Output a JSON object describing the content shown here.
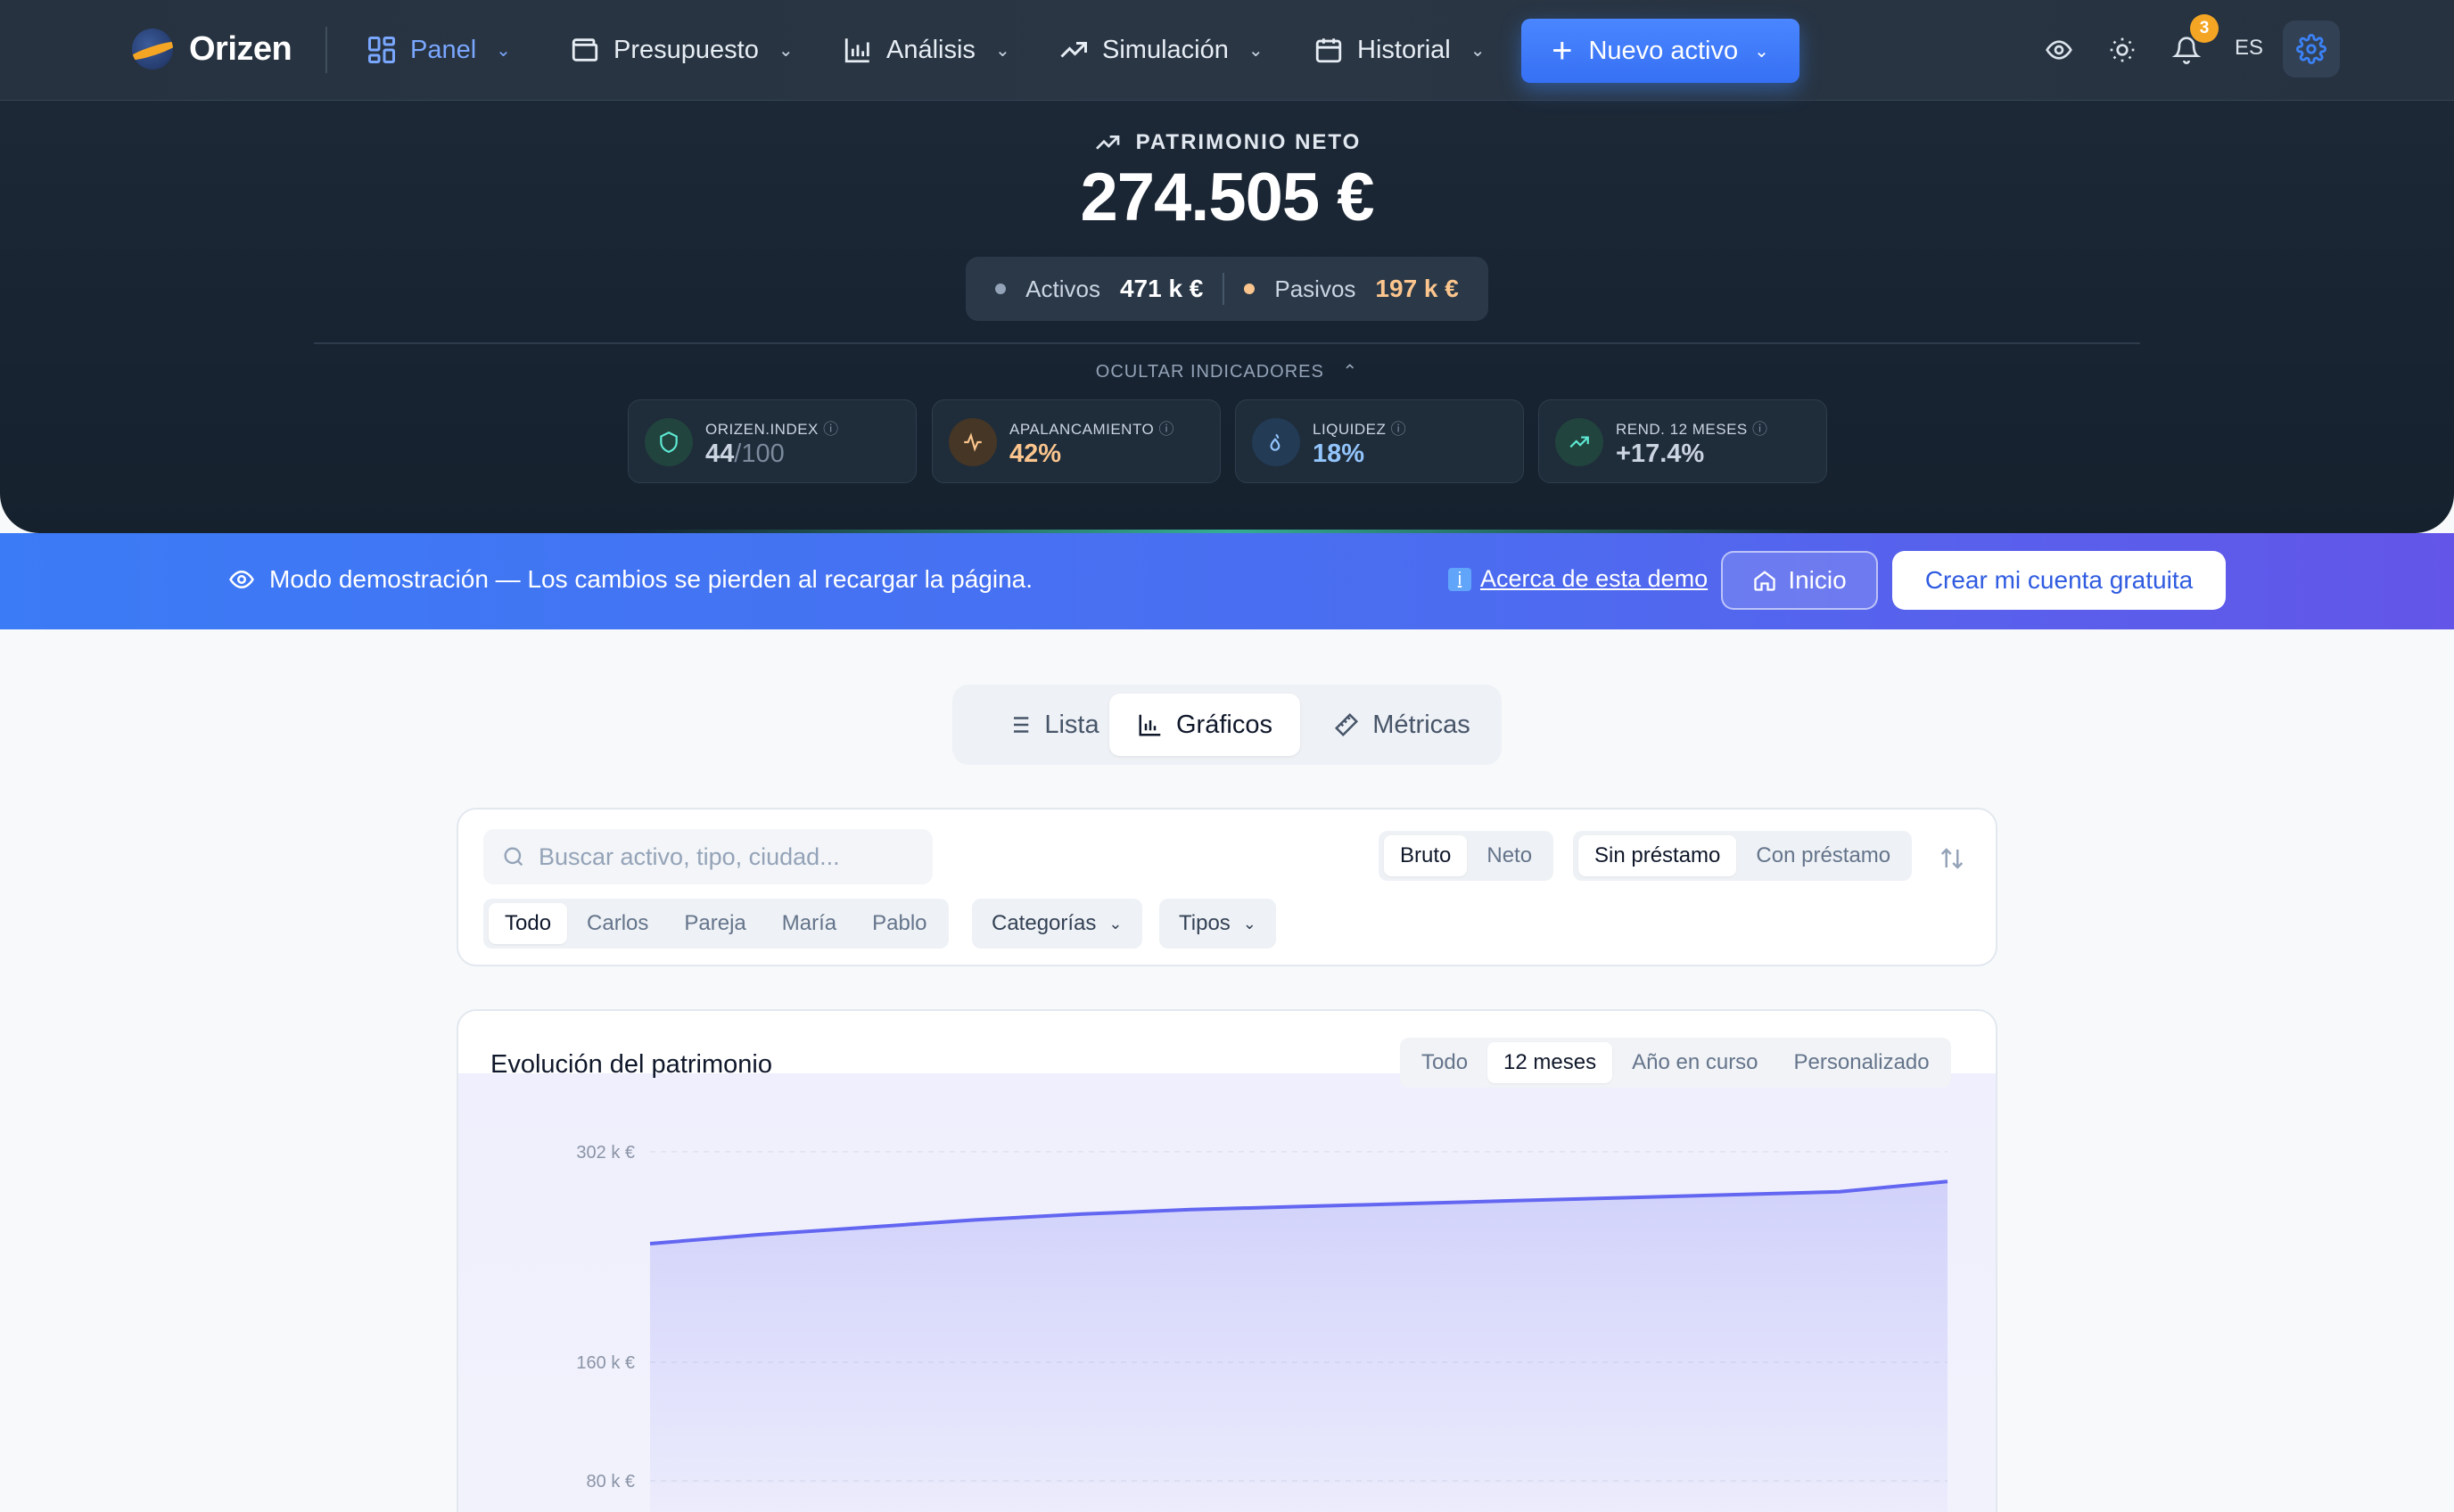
{
  "app": {
    "name": "Orizen"
  },
  "nav": {
    "items": [
      {
        "label": "Panel"
      },
      {
        "label": "Presupuesto"
      },
      {
        "label": "Análisis"
      },
      {
        "label": "Simulación"
      },
      {
        "label": "Historial"
      }
    ],
    "new_button": "Nuevo activo",
    "notifications_count": "3",
    "language": "ES"
  },
  "networth": {
    "label": "PATRIMONIO NETO",
    "value": "274.505 €",
    "assets_label": "Activos",
    "assets_value": "471 k €",
    "liabilities_label": "Pasivos",
    "liabilities_value": "197 k €",
    "hide_indicators": "OCULTAR INDICADORES"
  },
  "kpis": [
    {
      "label": "ORIZEN.INDEX",
      "value": "44",
      "suffix": "/100",
      "color": "#cbd5e1"
    },
    {
      "label": "APALANCAMIENTO",
      "value": "42%",
      "suffix": "",
      "color": "#fbc58d"
    },
    {
      "label": "LIQUIDEZ",
      "value": "18%",
      "suffix": "",
      "color": "#93c5fd"
    },
    {
      "label": "REND. 12 MESES",
      "value": "+17.4%",
      "suffix": "",
      "color": "#cbd5e1"
    }
  ],
  "demo": {
    "message": "Modo demostración — Los cambios se pierden al recargar la página.",
    "about_link": "Acerca de esta demo",
    "home_button": "Inicio",
    "create_button": "Crear mi cuenta gratuita"
  },
  "view_tabs": [
    {
      "label": "Lista",
      "active": false
    },
    {
      "label": "Gráficos",
      "active": true
    },
    {
      "label": "Métricas",
      "active": false
    }
  ],
  "filters": {
    "search_placeholder": "Buscar activo, tipo, ciudad...",
    "gross_net": [
      "Bruto",
      "Neto"
    ],
    "loan": [
      "Sin préstamo",
      "Con préstamo"
    ],
    "owners": [
      "Todo",
      "Carlos",
      "Pareja",
      "María",
      "Pablo"
    ],
    "categories": "Categorías",
    "types": "Tipos"
  },
  "chart": {
    "title": "Evolución del patrimonio",
    "ranges": [
      "Todo",
      "12 meses",
      "Año en curso",
      "Personalizado"
    ],
    "active_range": "12 meses"
  },
  "colors": {
    "accent": "#3b82f6",
    "line": "#6366f1",
    "demo_bar": "#4c6cf0"
  },
  "chart_data": {
    "type": "area",
    "title": "Evolución del patrimonio",
    "y_ticks": [
      {
        "value": 302,
        "label": "302 k €"
      },
      {
        "value": 160,
        "label": "160 k €"
      },
      {
        "value": 80,
        "label": "80 k €"
      }
    ],
    "series": [
      {
        "values": [
          240,
          246,
          251,
          256,
          260,
          263,
          265,
          267,
          269,
          271,
          273,
          275,
          282
        ]
      }
    ]
  }
}
